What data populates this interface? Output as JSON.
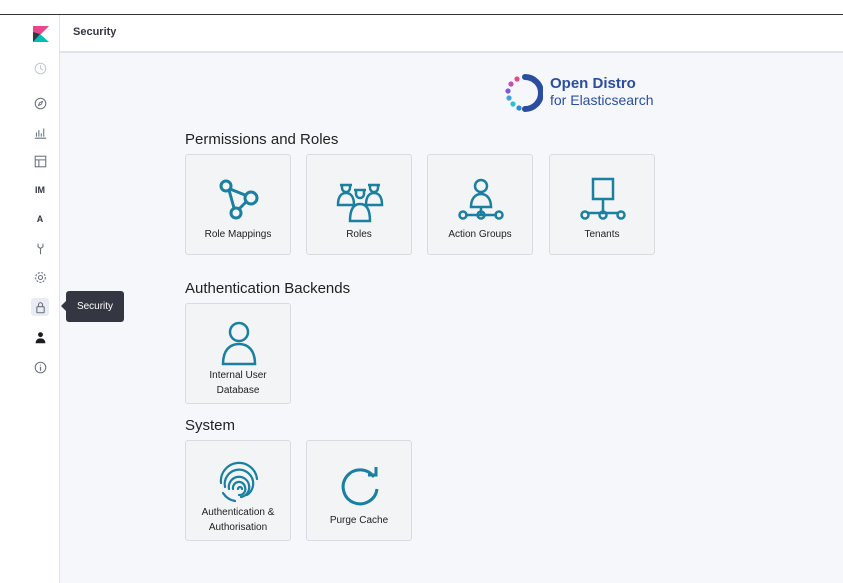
{
  "header": {
    "title": "Security"
  },
  "sidebar": {
    "items": [
      {
        "name": "recent-icon"
      },
      {
        "name": "discover-icon"
      },
      {
        "name": "visualize-icon"
      },
      {
        "name": "dashboard-icon"
      },
      {
        "name": "im",
        "text": "IM"
      },
      {
        "name": "a",
        "text": "A"
      },
      {
        "name": "dev-tools-icon"
      },
      {
        "name": "management-icon"
      },
      {
        "name": "security-lock-icon"
      },
      {
        "name": "user-icon"
      },
      {
        "name": "info-icon"
      }
    ],
    "tooltip": "Security"
  },
  "brand": {
    "line1": "Open Distro",
    "line2": "for Elasticsearch"
  },
  "sections": {
    "permissions": {
      "title": "Permissions and Roles",
      "cards": [
        "Role Mappings",
        "Roles",
        "Action Groups",
        "Tenants"
      ]
    },
    "auth": {
      "title": "Authentication Backends",
      "cards": [
        "Internal User Database"
      ],
      "card_line1": "Internal User",
      "card_line2": "Database"
    },
    "system": {
      "title": "System",
      "auth_line1": "Authentication &",
      "auth_line2": "Authorisation",
      "purge": "Purge Cache"
    }
  },
  "colors": {
    "icon": "#1a7fa0",
    "brand": "#2b4da0",
    "kibana_pink": "#e8478b",
    "kibana_teal": "#00bfb3"
  }
}
